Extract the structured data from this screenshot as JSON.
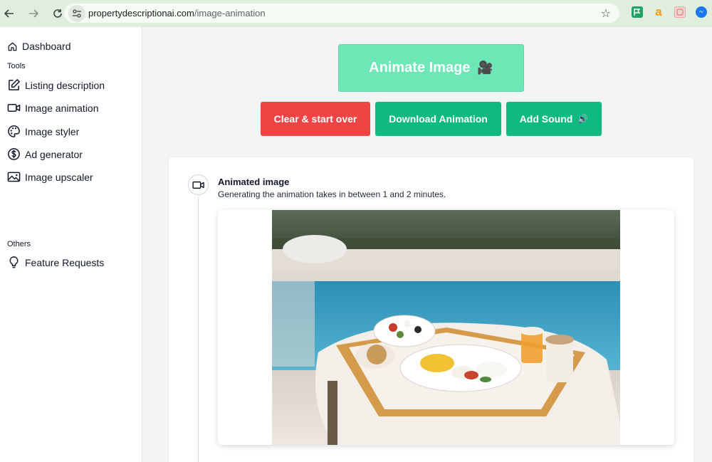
{
  "browser": {
    "url_domain": "propertydescriptionai.com",
    "url_path": "/image-animation",
    "back_icon": "back-arrow-icon",
    "forward_icon": "forward-arrow-icon",
    "reload_icon": "reload-icon",
    "bookmark_icon": "star-icon",
    "extensions": [
      {
        "name": "green-flag-extension",
        "color": "#1ea362"
      },
      {
        "name": "amazon-extension",
        "color": "#ff9900",
        "glyph": "a"
      },
      {
        "name": "photo-extension",
        "color": "#e9a4a0"
      },
      {
        "name": "messenger-extension",
        "color": "#1877f2"
      }
    ]
  },
  "sidebar": {
    "dashboard": "Dashboard",
    "tools_heading": "Tools",
    "items": [
      {
        "label": "Listing description",
        "icon": "edit-icon"
      },
      {
        "label": "Image animation",
        "icon": "video-camera-icon"
      },
      {
        "label": "Image styler",
        "icon": "palette-icon"
      },
      {
        "label": "Ad generator",
        "icon": "dollar-icon"
      },
      {
        "label": "Image upscaler",
        "icon": "image-icon"
      }
    ],
    "others_heading": "Others",
    "feature_requests": "Feature Requests"
  },
  "main": {
    "animate_button": "Animate Image",
    "animate_emoji": "🎥",
    "clear_button": "Clear & start over",
    "download_button": "Download Animation",
    "sound_button": "Add Sound",
    "sound_emoji": "🔊",
    "card_title": "Animated image",
    "card_subtitle": "Generating the animation takes in between 1 and 2 minutes."
  },
  "colors": {
    "animate_bg": "#6ee7b7",
    "clear_bg": "#ef4444",
    "primary_bg": "#10b981",
    "chrome_bg": "#dfeedd"
  }
}
